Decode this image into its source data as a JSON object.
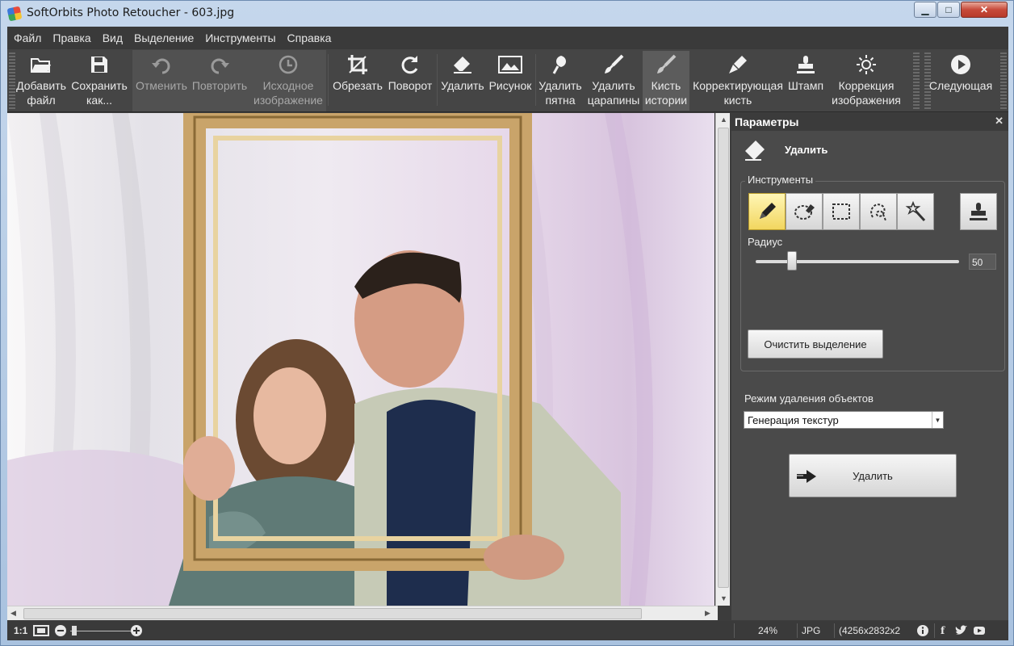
{
  "window": {
    "title": "SoftOrbits Photo Retoucher - 603.jpg",
    "minimize_label": "▁",
    "maximize_label": "□",
    "close_label": "✕"
  },
  "menu": [
    "Файл",
    "Правка",
    "Вид",
    "Выделение",
    "Инструменты",
    "Справка"
  ],
  "toolbar": {
    "add_file": [
      "Добавить",
      "файл"
    ],
    "save_as": [
      "Сохранить",
      "как..."
    ],
    "undo": "Отменить",
    "redo": "Повторить",
    "original": [
      "Исходное",
      "изображение"
    ],
    "crop": "Обрезать",
    "rotate": "Поворот",
    "delete": "Удалить",
    "picture": "Рисунок",
    "remove_spots": [
      "Удалить",
      "пятна"
    ],
    "remove_scratches": [
      "Удалить",
      "царапины"
    ],
    "history_brush": [
      "Кисть",
      "истории"
    ],
    "correcting_brush": [
      "Корректирующая",
      "кисть"
    ],
    "stamp": "Штамп",
    "image_correction": [
      "Коррекция",
      "изображения"
    ],
    "next": "Следующая"
  },
  "panel": {
    "title": "Параметры",
    "close_icon": "✕",
    "mode_title": "Удалить",
    "tools_group_label": "Инструменты",
    "radius_label": "Радиус",
    "radius_value": "50",
    "radius_fraction": 0.18,
    "clear_selection": "Очистить выделение",
    "removal_mode_label": "Режим удаления объектов",
    "removal_mode_value": "Генерация текстур",
    "delete_button": "Удалить"
  },
  "statusbar": {
    "ratio": "1:1",
    "zoom": "24%",
    "format": "JPG",
    "dimensions": "(4256x2832x2"
  },
  "colors": {
    "selected_tool": "#f2d65f",
    "dark_bg": "#3c3c3c",
    "panel_bg": "#4a4a4a"
  }
}
